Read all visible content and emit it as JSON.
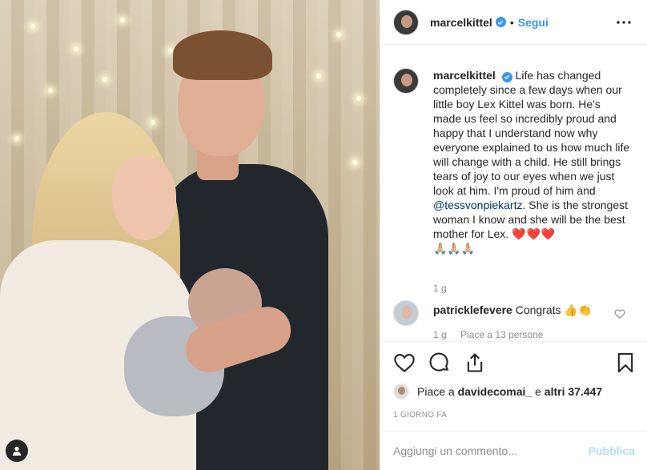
{
  "post": {
    "author": "marcelkittel",
    "follow_label": "Segui",
    "separator": "•",
    "caption": {
      "author": "marcelkittel",
      "text": "Life has changed completely since a few days when our little boy Lex Kittel was born. He's made us feel so incredibly proud and happy that I understand now why everyone explained to us how much life will change with a child. He still brings tears of joy to our eyes when we just look at him. I'm proud of him and ",
      "mention": "@tessvonpiekartz",
      "text_after": ". She is the strongest woman I know and she will be the best mother for Lex. ",
      "hearts": "❤️❤️❤️",
      "praying_hands": "🙏🏼🙏🏼🙏🏼",
      "age": "1 g"
    },
    "comment": {
      "author": "patricklefevere",
      "text": "Congrats 👍👏",
      "age": "1 g",
      "likes_label": "Piace a 13 persone"
    },
    "likes": {
      "prefix": "Piace a",
      "first_user": "davidecomai_",
      "conjunction": "e",
      "others": "altri 37.447"
    },
    "timestamp": "1 GIORNO FA",
    "composer": {
      "placeholder": "Aggiungi un commento...",
      "publish_label": "Pubblica"
    }
  },
  "icons": {
    "verified": "verified-badge-icon",
    "more": "more-options-icon",
    "like": "heart-icon",
    "comment": "comment-bubble-icon",
    "share": "share-icon",
    "save": "bookmark-icon",
    "profile": "user-profile-icon"
  },
  "colors": {
    "accent": "#3897f0",
    "publish_disabled": "#b2dffc",
    "text": "#262626",
    "muted": "#8e8e8e",
    "mention": "#00376b"
  }
}
